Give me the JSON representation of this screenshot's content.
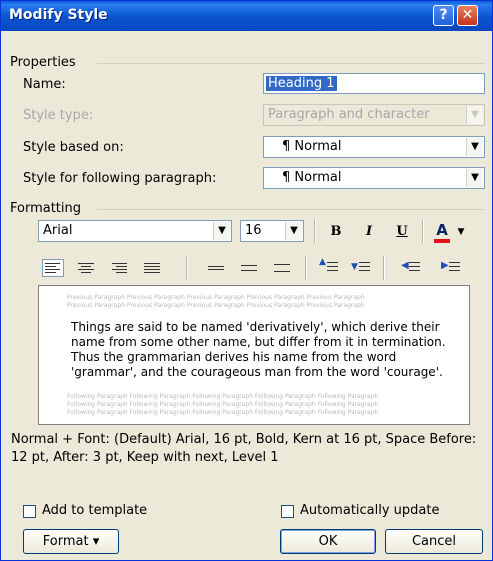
{
  "window": {
    "title": "Modify Style",
    "help_label": "?",
    "close_label": "✕"
  },
  "properties": {
    "group_label": "Properties",
    "name_label": "Name:",
    "name_value": "Heading 1",
    "style_type_label": "Style type:",
    "style_type_value": "Paragraph and character",
    "based_on_label": "Style based on:",
    "based_on_value": "¶ Normal",
    "following_label": "Style for following paragraph:",
    "following_value": "¶ Normal"
  },
  "formatting": {
    "group_label": "Formatting",
    "font_value": "Arial",
    "size_value": "16",
    "bold_label": "B",
    "italic_label": "I",
    "underline_label": "U",
    "font_color_label": "A",
    "font_color": "#e3111c"
  },
  "preview": {
    "prev_text": "Previous Paragraph Previous Paragraph Previous Paragraph Previous Paragraph Previous Paragraph",
    "following_text": "Following Paragraph Following Paragraph Following Paragraph Following Paragraph Following Paragraph",
    "sample_text": "Things are said to be named 'derivatively', which derive their name from some other name, but differ from it in termination. Thus the grammarian derives his name from the word 'grammar', and the courageous man from the word 'courage'."
  },
  "description": "Normal + Font: (Default) Arial, 16 pt, Bold, Kern at 16 pt, Space Before:  12 pt, After:  3 pt, Keep with next, Level 1",
  "options": {
    "add_to_template_label": "Add to template",
    "auto_update_label": "Automatically update"
  },
  "buttons": {
    "format_label": "Format ▾",
    "ok_label": "OK",
    "cancel_label": "Cancel"
  }
}
